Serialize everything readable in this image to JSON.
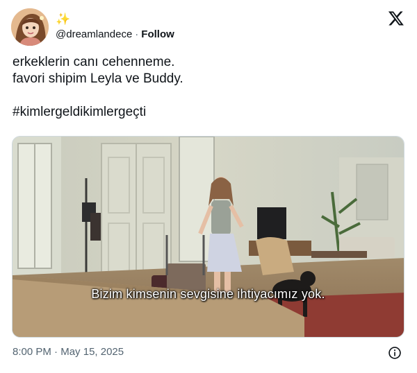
{
  "author": {
    "display_name_emoji": "✨",
    "handle": "@dreamlandece",
    "separator": "·",
    "follow_label": "Follow"
  },
  "tweet": {
    "lines": [
      "erkeklerin canı cehenneme.",
      "favori shipim Leyla ve Buddy."
    ],
    "hashtag": "#kimlergeldikimlergeçti"
  },
  "media": {
    "subtitle": "Bizim kimsenin sevgisine ihtiyacımız yok."
  },
  "footer": {
    "time": "8:00 PM",
    "separator": "·",
    "date": "May 15, 2025"
  },
  "icons": {
    "logo": "x-logo-icon",
    "info": "info-icon",
    "avatar": "avatar"
  },
  "colors": {
    "text": "#0f1419",
    "secondary": "#536471",
    "border": "#cfd9de"
  }
}
